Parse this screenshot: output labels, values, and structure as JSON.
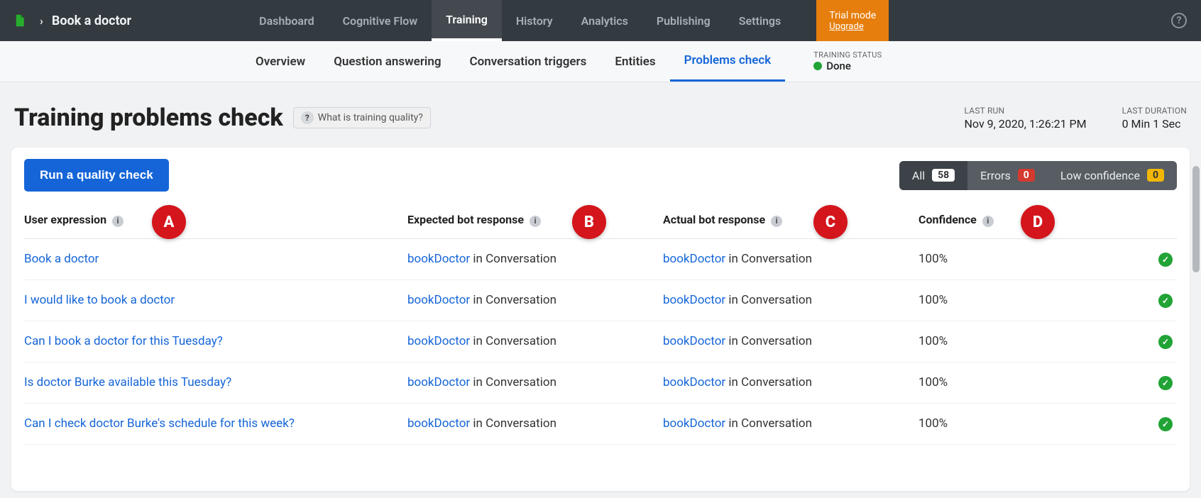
{
  "brand": {
    "app_name": "Book a doctor"
  },
  "topnav": {
    "items": [
      "Dashboard",
      "Cognitive Flow",
      "Training",
      "History",
      "Analytics",
      "Publishing",
      "Settings"
    ],
    "active_index": 2
  },
  "trial": {
    "label": "Trial mode",
    "action": "Upgrade"
  },
  "subnav": {
    "items": [
      "Overview",
      "Question answering",
      "Conversation triggers",
      "Entities",
      "Problems check"
    ],
    "active_index": 4
  },
  "training_status": {
    "label": "TRAINING STATUS",
    "value": "Done"
  },
  "page": {
    "title": "Training problems check",
    "help_chip": "What is training quality?",
    "last_run_label": "LAST RUN",
    "last_run_value": "Nov 9, 2020, 1:26:21 PM",
    "last_duration_label": "LAST DURATION",
    "last_duration_value": "0 Min 1 Sec",
    "run_button": "Run a quality check"
  },
  "filters": {
    "all_label": "All",
    "all_count": "58",
    "errors_label": "Errors",
    "errors_count": "0",
    "lowconf_label": "Low confidence",
    "lowconf_count": "0"
  },
  "columns": {
    "user_expression": "User expression",
    "expected": "Expected bot response",
    "actual": "Actual bot response",
    "confidence": "Confidence"
  },
  "common": {
    "intent": "bookDoctor",
    "suffix": " in Conversation"
  },
  "rows": [
    {
      "expression": "Book a doctor",
      "confidence": "100%"
    },
    {
      "expression": "I would like to book a doctor",
      "confidence": "100%"
    },
    {
      "expression": "Can I book a doctor for this Tuesday?",
      "confidence": "100%"
    },
    {
      "expression": "Is doctor Burke available this Tuesday?",
      "confidence": "100%"
    },
    {
      "expression": "Can I check doctor Burke's schedule for this week?",
      "confidence": "100%"
    }
  ],
  "annotations": {
    "a": "A",
    "b": "B",
    "c": "C",
    "d": "D"
  }
}
